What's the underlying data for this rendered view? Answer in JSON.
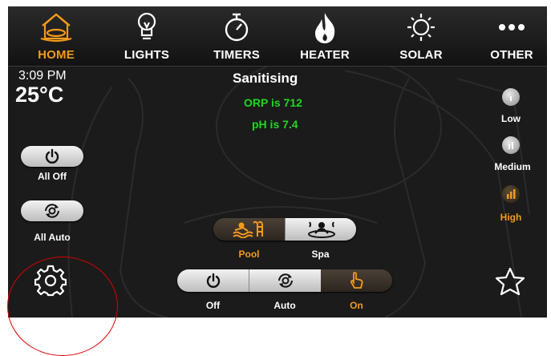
{
  "nav": {
    "home": "HOME",
    "lights": "LIGHTS",
    "timers": "TIMERS",
    "heater": "HEATER",
    "solar": "SOLAR",
    "other": "OTHER",
    "active": "home",
    "active_color": "#f49a1a"
  },
  "status": {
    "time": "3:09 PM",
    "temperature": "25°C",
    "title": "Sanitising",
    "orp": "ORP is 712",
    "ph": "pH is 7.4",
    "reading_color": "#1fd81f"
  },
  "global_buttons": {
    "all_off": "All Off",
    "all_auto": "All Auto"
  },
  "mode_selector": {
    "pool": "Pool",
    "spa": "Spa",
    "selected": "pool"
  },
  "power_selector": {
    "off": "Off",
    "auto": "Auto",
    "on": "On",
    "selected": "on"
  },
  "pump_speed": {
    "low": "Low",
    "medium": "Medium",
    "high": "High",
    "selected": "high"
  },
  "icons": {
    "nav": [
      "home-icon",
      "lightbulb-icon",
      "stopwatch-icon",
      "flame-icon",
      "sun-icon",
      "more-icon"
    ],
    "settings": "gear-icon",
    "favourites": "star-icon"
  },
  "annotation": {
    "highlight_color": "#e00000"
  }
}
